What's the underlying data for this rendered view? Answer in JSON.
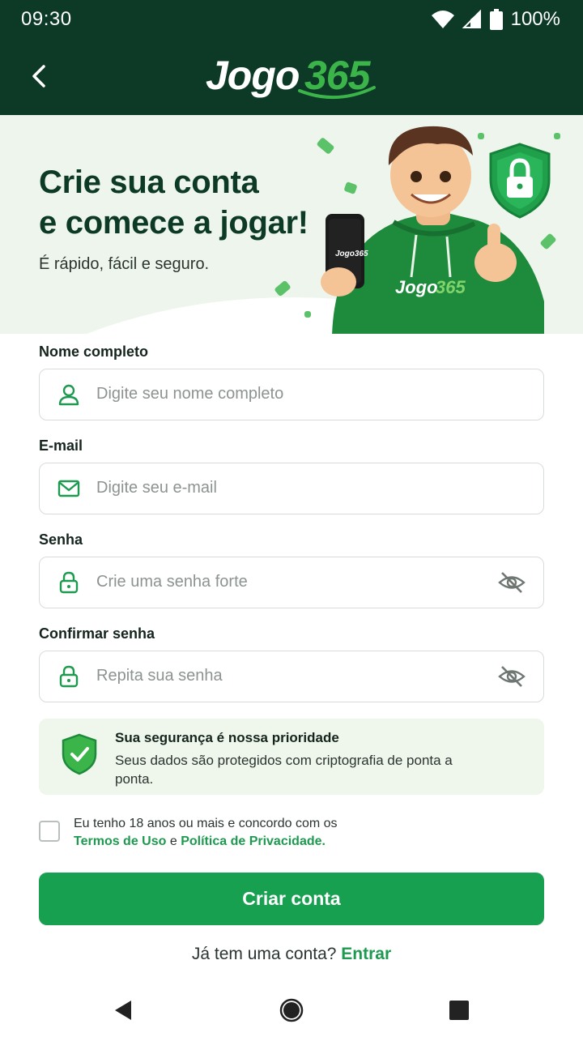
{
  "status_bar": {
    "time": "09:30",
    "battery": "100%"
  },
  "header": {
    "logo_word": "Jogo",
    "logo_number": "365"
  },
  "hero": {
    "title_line1": "Crie sua conta",
    "title_line2": "e comece a jogar!",
    "subtitle": "É rápido, fácil e seguro.",
    "phone_logo": "Jogo365",
    "hoodie_logo_word": "Jogo",
    "hoodie_logo_number": "365"
  },
  "form": {
    "name": {
      "label": "Nome completo",
      "placeholder": "Digite seu nome completo"
    },
    "email": {
      "label": "E-mail",
      "placeholder": "Digite seu e-mail"
    },
    "password": {
      "label": "Senha",
      "placeholder": "Crie uma senha forte"
    },
    "confirm": {
      "label": "Confirmar senha",
      "placeholder": "Repita sua senha"
    }
  },
  "security_notice": {
    "title": "Sua segurança é nossa prioridade",
    "description": "Seus dados são protegidos com criptografia de ponta a ponta."
  },
  "terms": {
    "text_before": "Eu tenho 18 anos ou mais e concordo com os",
    "terms_link": "Termos de Uso",
    "connector": "e",
    "privacy_link": "Política de Privacidade."
  },
  "cta_label": "Criar conta",
  "login_prompt": {
    "text": "Já tem uma conta?",
    "link": "Entrar"
  },
  "colors": {
    "header_bg": "#0d3a26",
    "hero_bg": "#eef5ec",
    "accent_green": "#16a050",
    "link_green": "#1d9a4f",
    "logo_green": "#3bb54a"
  },
  "icons": [
    "wifi-icon",
    "signal-icon",
    "battery-icon",
    "back-arrow-icon",
    "user-icon",
    "mail-icon",
    "lock-icon",
    "eye-off-icon",
    "shield-check-icon",
    "nav-back-icon",
    "nav-home-icon",
    "nav-recents-icon"
  ]
}
